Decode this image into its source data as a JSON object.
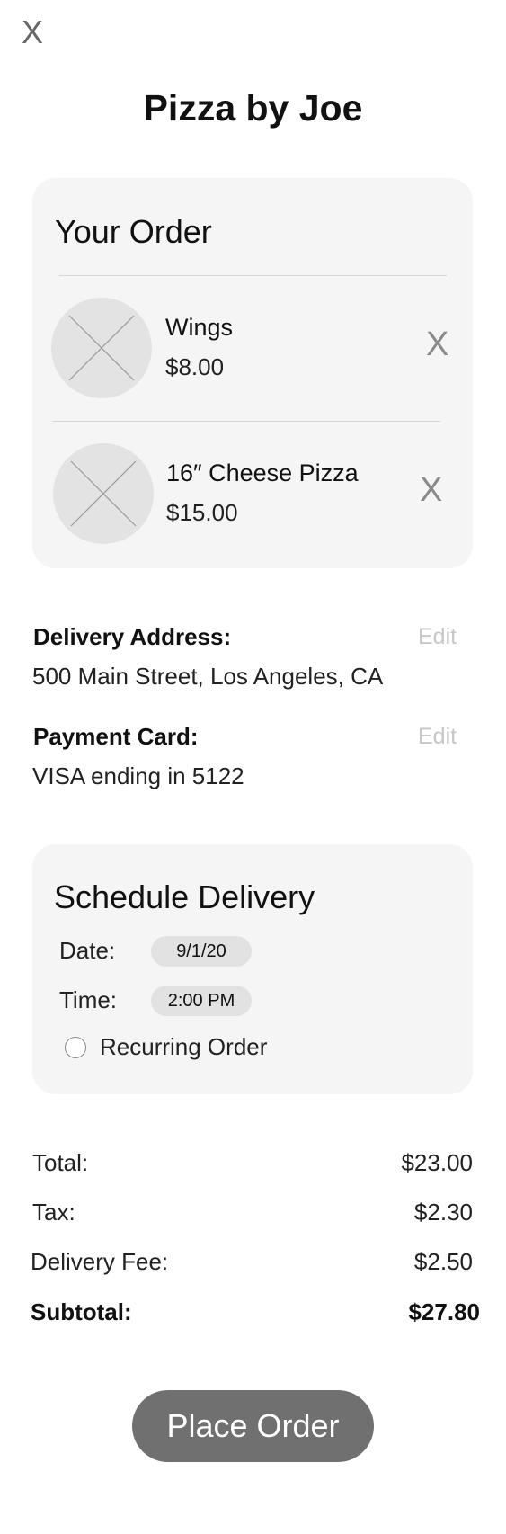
{
  "header": {
    "close_label": "X",
    "title": "Pizza by Joe"
  },
  "order": {
    "heading": "Your Order",
    "items": [
      {
        "name": "Wings",
        "price": "$8.00",
        "remove_label": "X",
        "image_icon": "image-placeholder-icon"
      },
      {
        "name": "16″ Cheese Pizza",
        "price": "$15.00",
        "remove_label": "X",
        "image_icon": "image-placeholder-icon"
      }
    ]
  },
  "delivery": {
    "label": "Delivery Address:",
    "value": "500 Main Street, Los Angeles, CA",
    "edit_label": "Edit"
  },
  "payment": {
    "label": "Payment Card:",
    "value": "VISA ending in 5122",
    "edit_label": "Edit"
  },
  "schedule": {
    "heading": "Schedule Delivery",
    "date_label": "Date:",
    "date_value": "9/1/20",
    "time_label": "Time:",
    "time_value": "2:00 PM",
    "recurring_label": "Recurring Order",
    "recurring_checked": false
  },
  "summary": {
    "total_label": "Total:",
    "total_value": "$23.00",
    "tax_label": "Tax:",
    "tax_value": "$2.30",
    "fee_label": "Delivery Fee:",
    "fee_value": "$2.50",
    "subtotal_label": "Subtotal:",
    "subtotal_value": "$27.80"
  },
  "actions": {
    "place_order_label": "Place Order"
  },
  "colors": {
    "card_background": "#f5f5f5",
    "button_background": "#707070",
    "edit_link": "#c7c7c7",
    "remove_icon": "#8a8a8a"
  }
}
